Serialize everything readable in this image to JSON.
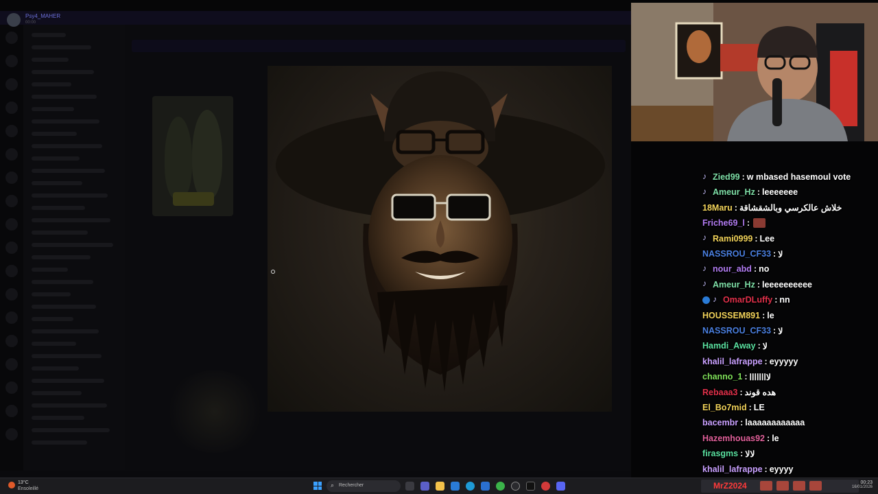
{
  "app": {
    "user_name": "Psy4_MAHER",
    "user_status": "00:00"
  },
  "chat": {
    "messages": [
      {
        "badges": [
          "note"
        ],
        "user": "Zied99",
        "color": "#7fe0a8",
        "text": "w mbased hasemoul vote"
      },
      {
        "badges": [
          "note"
        ],
        "user": "Ameur_Hz",
        "color": "#7fe0a8",
        "text": "leeeeeee"
      },
      {
        "badges": [],
        "user": "18Maru",
        "color": "#f2d35a",
        "text": "خلاش عالكرسي وبالشقشاقة"
      },
      {
        "badges": [],
        "user": "Friche69_l",
        "color": "#b27cf2",
        "text": "",
        "emote": true
      },
      {
        "badges": [
          "note"
        ],
        "user": "Rami0999",
        "color": "#f2d35a",
        "text": "Lee"
      },
      {
        "badges": [],
        "user": "NASSROU_CF33",
        "color": "#4a7fe0",
        "text": "لا"
      },
      {
        "badges": [
          "note"
        ],
        "user": "nour_abd",
        "color": "#b27cf2",
        "text": "no"
      },
      {
        "badges": [
          "note"
        ],
        "user": "Ameur_Hz",
        "color": "#7fe0a8",
        "text": "leeeeeeeeee"
      },
      {
        "badges": [
          "gem",
          "note"
        ],
        "user": "OmarDLuffy",
        "color": "#e0304a",
        "text": "nn"
      },
      {
        "badges": [],
        "user": "HOUSSEM891",
        "color": "#f2d35a",
        "text": "le"
      },
      {
        "badges": [],
        "user": "NASSROU_CF33",
        "color": "#4a7fe0",
        "text": "لا"
      },
      {
        "badges": [],
        "user": "Hamdi_Away",
        "color": "#5ae0a0",
        "text": "لا"
      },
      {
        "badges": [],
        "user": "khalil_lafrappe",
        "color": "#c9a0ff",
        "text": "eyyyyy"
      },
      {
        "badges": [],
        "user": "channo_1",
        "color": "#7fe05a",
        "text": "لاااااااا"
      },
      {
        "badges": [],
        "user": "Rebaaa3",
        "color": "#e0304a",
        "text": "هده قوند"
      },
      {
        "badges": [],
        "user": "El_Bo7mid",
        "color": "#f2d35a",
        "text": "LE"
      },
      {
        "badges": [],
        "user": "bacembr",
        "color": "#c9a0ff",
        "text": "laaaaaaaaaaaa"
      },
      {
        "badges": [],
        "user": "Hazemhouas92",
        "color": "#e0609a",
        "text": "le"
      },
      {
        "badges": [],
        "user": "firasgms",
        "color": "#5ae0a0",
        "text": "لالا"
      },
      {
        "badges": [],
        "user": "khalil_lafrappe",
        "color": "#c9a0ff",
        "text": "eyyyy"
      }
    ]
  },
  "taskbar": {
    "temperature": "13°C",
    "weather_desc": "Ensoleillé",
    "search_placeholder": "Rechercher",
    "stream_label": "MrZ2024",
    "time": "00:23",
    "date": "16/01/2026"
  },
  "colors": {
    "taskbar_bg": "#1c1c1f",
    "accent_blue": "#3aa0ff",
    "live_red": "#ff3a3a"
  },
  "icons": [
    "start-icon",
    "search-icon",
    "file-explorer-icon",
    "teams-icon",
    "folder-icon",
    "store-icon",
    "edge-icon",
    "chrome-icon",
    "obs-icon",
    "settings-icon"
  ]
}
